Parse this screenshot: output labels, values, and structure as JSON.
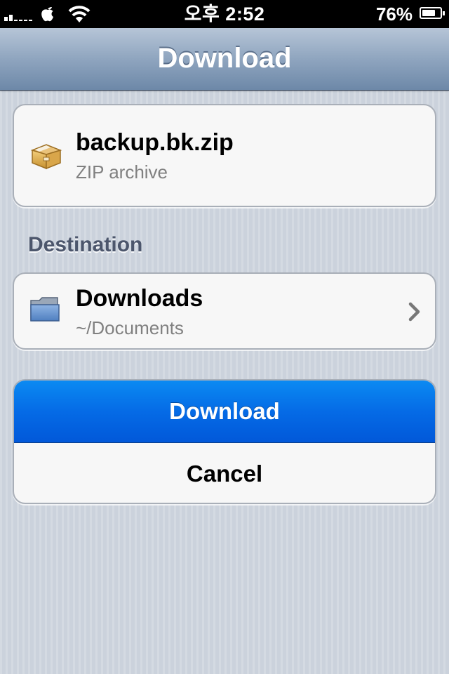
{
  "status_bar": {
    "time": "오후 2:52",
    "battery_percent": "76%",
    "battery_level": 0.76,
    "signal_bars": 2
  },
  "nav": {
    "title": "Download"
  },
  "file": {
    "name": "backup.bk.zip",
    "type": "ZIP archive",
    "icon": "zip-archive-icon"
  },
  "destination": {
    "header": "Destination",
    "folder_name": "Downloads",
    "path": "~/Documents",
    "icon": "folder-icon"
  },
  "actions": {
    "download_label": "Download",
    "cancel_label": "Cancel"
  },
  "colors": {
    "accent": "#0a6ee8",
    "nav": "#7d95b3",
    "background": "#cbd2dc"
  }
}
